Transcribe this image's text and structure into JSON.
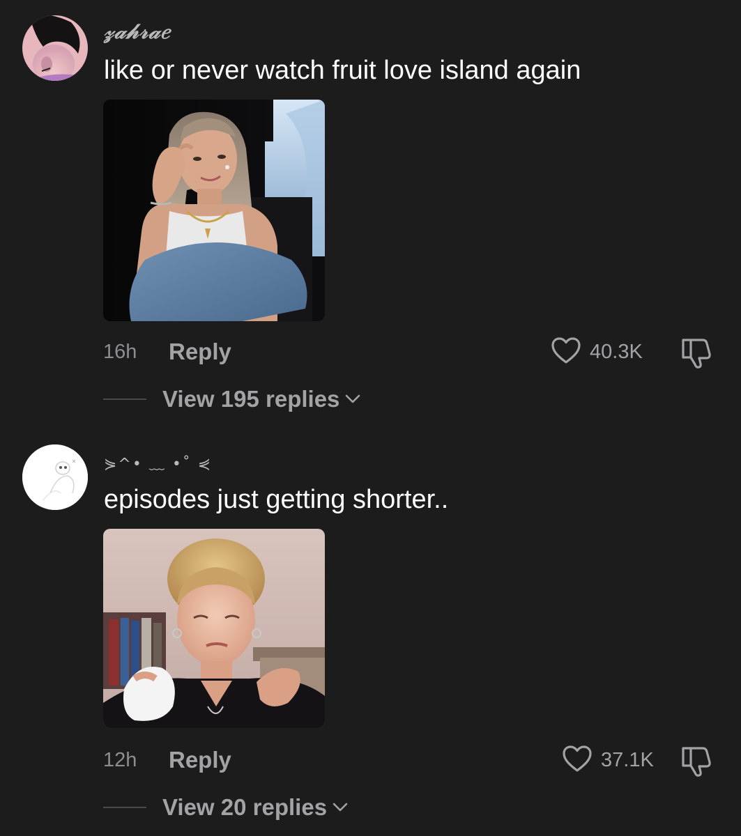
{
  "comments": [
    {
      "username": "𝓏𝒶𝒽𝓇𝒶𝑒",
      "text": "like or never watch fruit love island again",
      "media_icon": "gif-image",
      "time": "16h",
      "reply_label": "Reply",
      "like_count": "40.3K",
      "view_replies": "View 195 replies"
    },
    {
      "username": "⋟^• ﹏ •˚ ⋞",
      "text": "episodes just getting shorter..",
      "media_icon": "gif-image",
      "time": "12h",
      "reply_label": "Reply",
      "like_count": "37.1K",
      "view_replies": "View 20 replies"
    }
  ],
  "icons": {
    "like": "heart-outline-icon",
    "dislike": "thumbs-down-icon",
    "expand": "chevron-down-icon"
  },
  "colors": {
    "background": "#1c1c1d",
    "primary_text": "#ffffff",
    "secondary_text": "#a3a3a6",
    "muted_text": "#8e8e92"
  }
}
